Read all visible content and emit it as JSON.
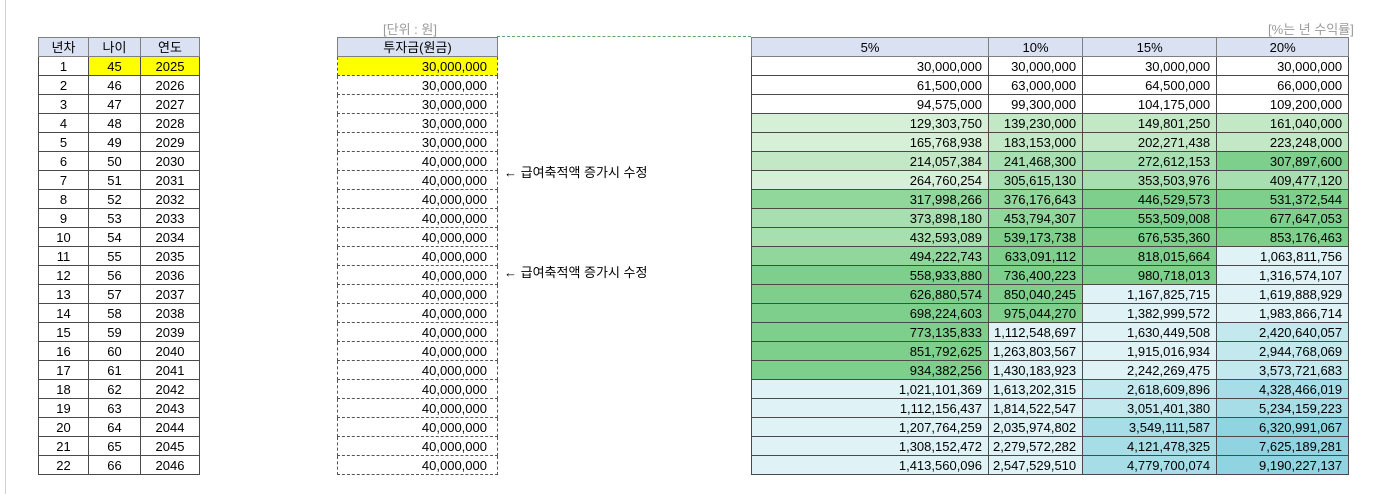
{
  "notes": {
    "unit": "[단위 : 원]",
    "pct": "[%는 년 수익률]"
  },
  "left_headers": [
    "년차",
    "나이",
    "연도"
  ],
  "principal_header": "투자금(원금)",
  "rate_headers": [
    "5%",
    "10%",
    "15%",
    "20%"
  ],
  "annotations": [
    "← 급여축적액 증가시 수정",
    "← 급여축적액 증가시 수정"
  ],
  "rows": [
    {
      "y": "1",
      "age": "45",
      "year": "2025",
      "p": "30,000,000",
      "v": [
        "30,000,000",
        "30,000,000",
        "30,000,000",
        "30,000,000"
      ]
    },
    {
      "y": "2",
      "age": "46",
      "year": "2026",
      "p": "30,000,000",
      "v": [
        "61,500,000",
        "63,000,000",
        "64,500,000",
        "66,000,000"
      ]
    },
    {
      "y": "3",
      "age": "47",
      "year": "2027",
      "p": "30,000,000",
      "v": [
        "94,575,000",
        "99,300,000",
        "104,175,000",
        "109,200,000"
      ]
    },
    {
      "y": "4",
      "age": "48",
      "year": "2028",
      "p": "30,000,000",
      "v": [
        "129,303,750",
        "139,230,000",
        "149,801,250",
        "161,040,000"
      ]
    },
    {
      "y": "5",
      "age": "49",
      "year": "2029",
      "p": "30,000,000",
      "v": [
        "165,768,938",
        "183,153,000",
        "202,271,438",
        "223,248,000"
      ]
    },
    {
      "y": "6",
      "age": "50",
      "year": "2030",
      "p": "40,000,000",
      "v": [
        "214,057,384",
        "241,468,300",
        "272,612,153",
        "307,897,600"
      ]
    },
    {
      "y": "7",
      "age": "51",
      "year": "2031",
      "p": "40,000,000",
      "v": [
        "264,760,254",
        "305,615,130",
        "353,503,976",
        "409,477,120"
      ]
    },
    {
      "y": "8",
      "age": "52",
      "year": "2032",
      "p": "40,000,000",
      "v": [
        "317,998,266",
        "376,176,643",
        "446,529,573",
        "531,372,544"
      ]
    },
    {
      "y": "9",
      "age": "53",
      "year": "2033",
      "p": "40,000,000",
      "v": [
        "373,898,180",
        "453,794,307",
        "553,509,008",
        "677,647,053"
      ]
    },
    {
      "y": "10",
      "age": "54",
      "year": "2034",
      "p": "40,000,000",
      "v": [
        "432,593,089",
        "539,173,738",
        "676,535,360",
        "853,176,463"
      ]
    },
    {
      "y": "11",
      "age": "55",
      "year": "2035",
      "p": "40,000,000",
      "v": [
        "494,222,743",
        "633,091,112",
        "818,015,664",
        "1,063,811,756"
      ]
    },
    {
      "y": "12",
      "age": "56",
      "year": "2036",
      "p": "40,000,000",
      "v": [
        "558,933,880",
        "736,400,223",
        "980,718,013",
        "1,316,574,107"
      ]
    },
    {
      "y": "13",
      "age": "57",
      "year": "2037",
      "p": "40,000,000",
      "v": [
        "626,880,574",
        "850,040,245",
        "1,167,825,715",
        "1,619,888,929"
      ]
    },
    {
      "y": "14",
      "age": "58",
      "year": "2038",
      "p": "40,000,000",
      "v": [
        "698,224,603",
        "975,044,270",
        "1,382,999,572",
        "1,983,866,714"
      ]
    },
    {
      "y": "15",
      "age": "59",
      "year": "2039",
      "p": "40,000,000",
      "v": [
        "773,135,833",
        "1,112,548,697",
        "1,630,449,508",
        "2,420,640,057"
      ]
    },
    {
      "y": "16",
      "age": "60",
      "year": "2040",
      "p": "40,000,000",
      "v": [
        "851,792,625",
        "1,263,803,567",
        "1,915,016,934",
        "2,944,768,069"
      ]
    },
    {
      "y": "17",
      "age": "61",
      "year": "2041",
      "p": "40,000,000",
      "v": [
        "934,382,256",
        "1,430,183,923",
        "2,242,269,475",
        "3,573,721,683"
      ]
    },
    {
      "y": "18",
      "age": "62",
      "year": "2042",
      "p": "40,000,000",
      "v": [
        "1,021,101,369",
        "1,613,202,315",
        "2,618,609,896",
        "4,328,466,019"
      ]
    },
    {
      "y": "19",
      "age": "63",
      "year": "2043",
      "p": "40,000,000",
      "v": [
        "1,112,156,437",
        "1,814,522,547",
        "3,051,401,380",
        "5,234,159,223"
      ]
    },
    {
      "y": "20",
      "age": "64",
      "year": "2044",
      "p": "40,000,000",
      "v": [
        "1,207,764,259",
        "2,035,974,802",
        "3,549,111,587",
        "6,320,991,067"
      ]
    },
    {
      "y": "21",
      "age": "65",
      "year": "2045",
      "p": "40,000,000",
      "v": [
        "1,308,152,472",
        "2,279,572,282",
        "4,121,478,325",
        "7,625,189,281"
      ]
    },
    {
      "y": "22",
      "age": "66",
      "year": "2046",
      "p": "40,000,000",
      "v": [
        "1,413,560,096",
        "2,547,529,510",
        "4,779,700,074",
        "9,190,227,137"
      ]
    }
  ],
  "colors": {
    "header_bg": "#d9e1f2",
    "highlight": "#ffff00",
    "green_scale": [
      "#d6f0d8",
      "#c2e8c6",
      "#a8dfb0",
      "#91d69b",
      "#7fcf8c"
    ],
    "cyan_scale": [
      "#dff3f6",
      "#c3e9ef",
      "#a6dde7",
      "#8fd4e0"
    ]
  }
}
